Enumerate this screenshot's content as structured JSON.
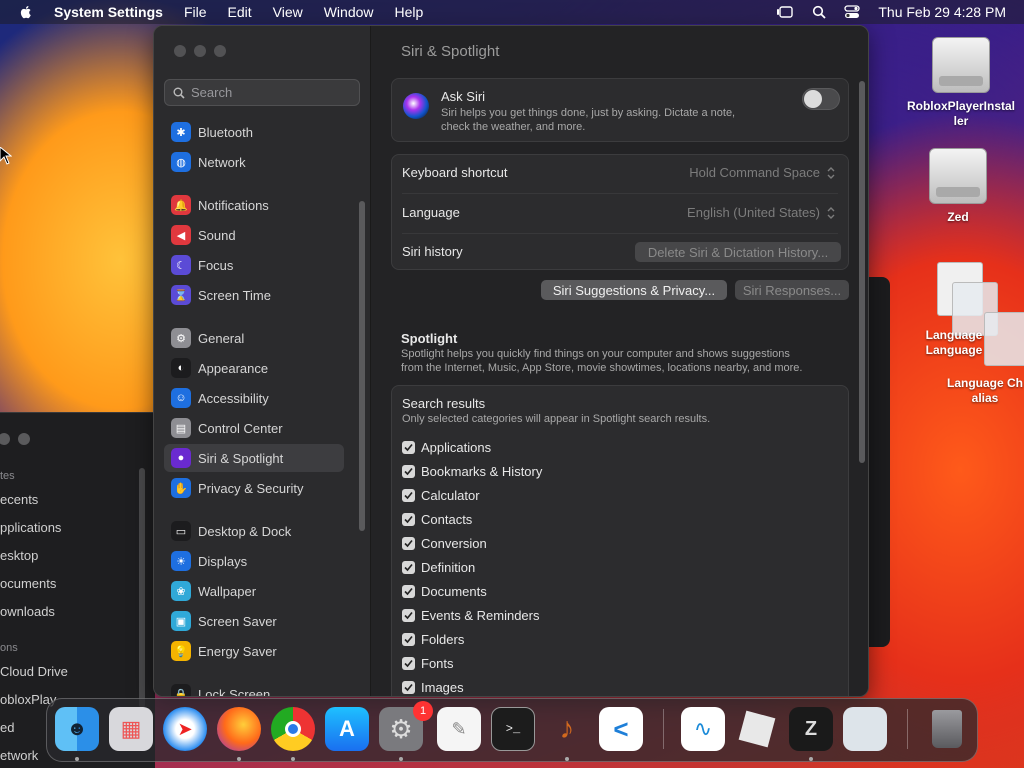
{
  "menubar": {
    "app_name": "System Settings",
    "menus": [
      "File",
      "Edit",
      "View",
      "Window",
      "Help"
    ],
    "clock": "Thu Feb 29  4:28 PM"
  },
  "finder": {
    "section_favorites": "tes",
    "items_fav": [
      "ecents",
      "pplications",
      "esktop",
      "ocuments",
      "ownloads"
    ],
    "section_locations": "ons",
    "items_loc": [
      "Cloud Drive",
      "obloxPlay",
      "ed",
      "etwork"
    ]
  },
  "settings": {
    "search_placeholder": "Search",
    "sidebar": [
      {
        "label": "Bluetooth",
        "icon": "bluetooth-icon",
        "color": "#1e6fe0",
        "glyph": "✱"
      },
      {
        "label": "Network",
        "icon": "globe-icon",
        "color": "#1e6fe0",
        "glyph": "◍"
      },
      {
        "label": "Notifications",
        "icon": "bell-icon",
        "color": "#e0383e",
        "glyph": "🔔"
      },
      {
        "label": "Sound",
        "icon": "speaker-icon",
        "color": "#e0383e",
        "glyph": "◀"
      },
      {
        "label": "Focus",
        "icon": "moon-icon",
        "color": "#5b4bd6",
        "glyph": "☾"
      },
      {
        "label": "Screen Time",
        "icon": "hourglass-icon",
        "color": "#5b4bd6",
        "glyph": "⌛"
      },
      {
        "label": "General",
        "icon": "gear-icon",
        "color": "#8e8e93",
        "glyph": "⚙"
      },
      {
        "label": "Appearance",
        "icon": "appearance-icon",
        "color": "#1c1c1e",
        "glyph": "◐"
      },
      {
        "label": "Accessibility",
        "icon": "accessibility-icon",
        "color": "#1e6fe0",
        "glyph": "☺"
      },
      {
        "label": "Control Center",
        "icon": "control-center-icon",
        "color": "#8e8e93",
        "glyph": "▤"
      },
      {
        "label": "Siri & Spotlight",
        "icon": "siri-icon",
        "color": "#6a2ad0",
        "glyph": "●"
      },
      {
        "label": "Privacy & Security",
        "icon": "hand-icon",
        "color": "#1e6fe0",
        "glyph": "✋"
      },
      {
        "label": "Desktop & Dock",
        "icon": "dock-icon",
        "color": "#1c1c1e",
        "glyph": "▭"
      },
      {
        "label": "Displays",
        "icon": "display-icon",
        "color": "#1e6fe0",
        "glyph": "☀"
      },
      {
        "label": "Wallpaper",
        "icon": "wallpaper-icon",
        "color": "#30a9d8",
        "glyph": "❀"
      },
      {
        "label": "Screen Saver",
        "icon": "screen-saver-icon",
        "color": "#30a9d8",
        "glyph": "▣"
      },
      {
        "label": "Energy Saver",
        "icon": "energy-icon",
        "color": "#f5b400",
        "glyph": "💡"
      },
      {
        "label": "Lock Screen",
        "icon": "lock-icon",
        "color": "#1c1c1e",
        "glyph": "🔒"
      }
    ],
    "page_title": "Siri & Spotlight",
    "ask_siri": {
      "label": "Ask Siri",
      "desc1": "Siri helps you get things done, just by asking. Dictate a note,",
      "desc2": "check the weather, and more.",
      "enabled": false
    },
    "keyboard_shortcut": {
      "label": "Keyboard shortcut",
      "value": "Hold Command Space"
    },
    "language": {
      "label": "Language",
      "value": "English (United States)"
    },
    "siri_history": {
      "label": "Siri history",
      "button": "Delete Siri & Dictation History..."
    },
    "siri_suggestions_button": "Siri Suggestions & Privacy...",
    "siri_responses_button": "Siri Responses...",
    "spotlight": {
      "title": "Spotlight",
      "desc1": "Spotlight helps you quickly find things on your computer and shows suggestions",
      "desc2": "from the Internet, Music, App Store, movie showtimes, locations nearby, and more."
    },
    "search_results": {
      "title": "Search results",
      "desc": "Only selected categories will appear in Spotlight search results.",
      "items": [
        "Applications",
        "Bookmarks & History",
        "Calculator",
        "Contacts",
        "Conversion",
        "Definition",
        "Documents",
        "Events & Reminders",
        "Folders",
        "Fonts",
        "Images"
      ]
    }
  },
  "desktop": {
    "icons": [
      "RobloxPlayerInstal",
      "ler",
      "Zed",
      "Language",
      "Language",
      "Language Ch",
      "alias"
    ]
  },
  "dock": {
    "badge": "1",
    "apps": [
      "finder-icon",
      "launchpad-icon",
      "safari-icon",
      "firefox-icon",
      "chrome-icon",
      "app-store-icon",
      "system-settings-icon",
      "textedit-icon",
      "terminal-icon",
      "garageband-icon",
      "vscode-icon",
      "freeform-icon",
      "roblox-icon",
      "zed-icon",
      "blank-app-icon",
      "trash-icon"
    ]
  }
}
